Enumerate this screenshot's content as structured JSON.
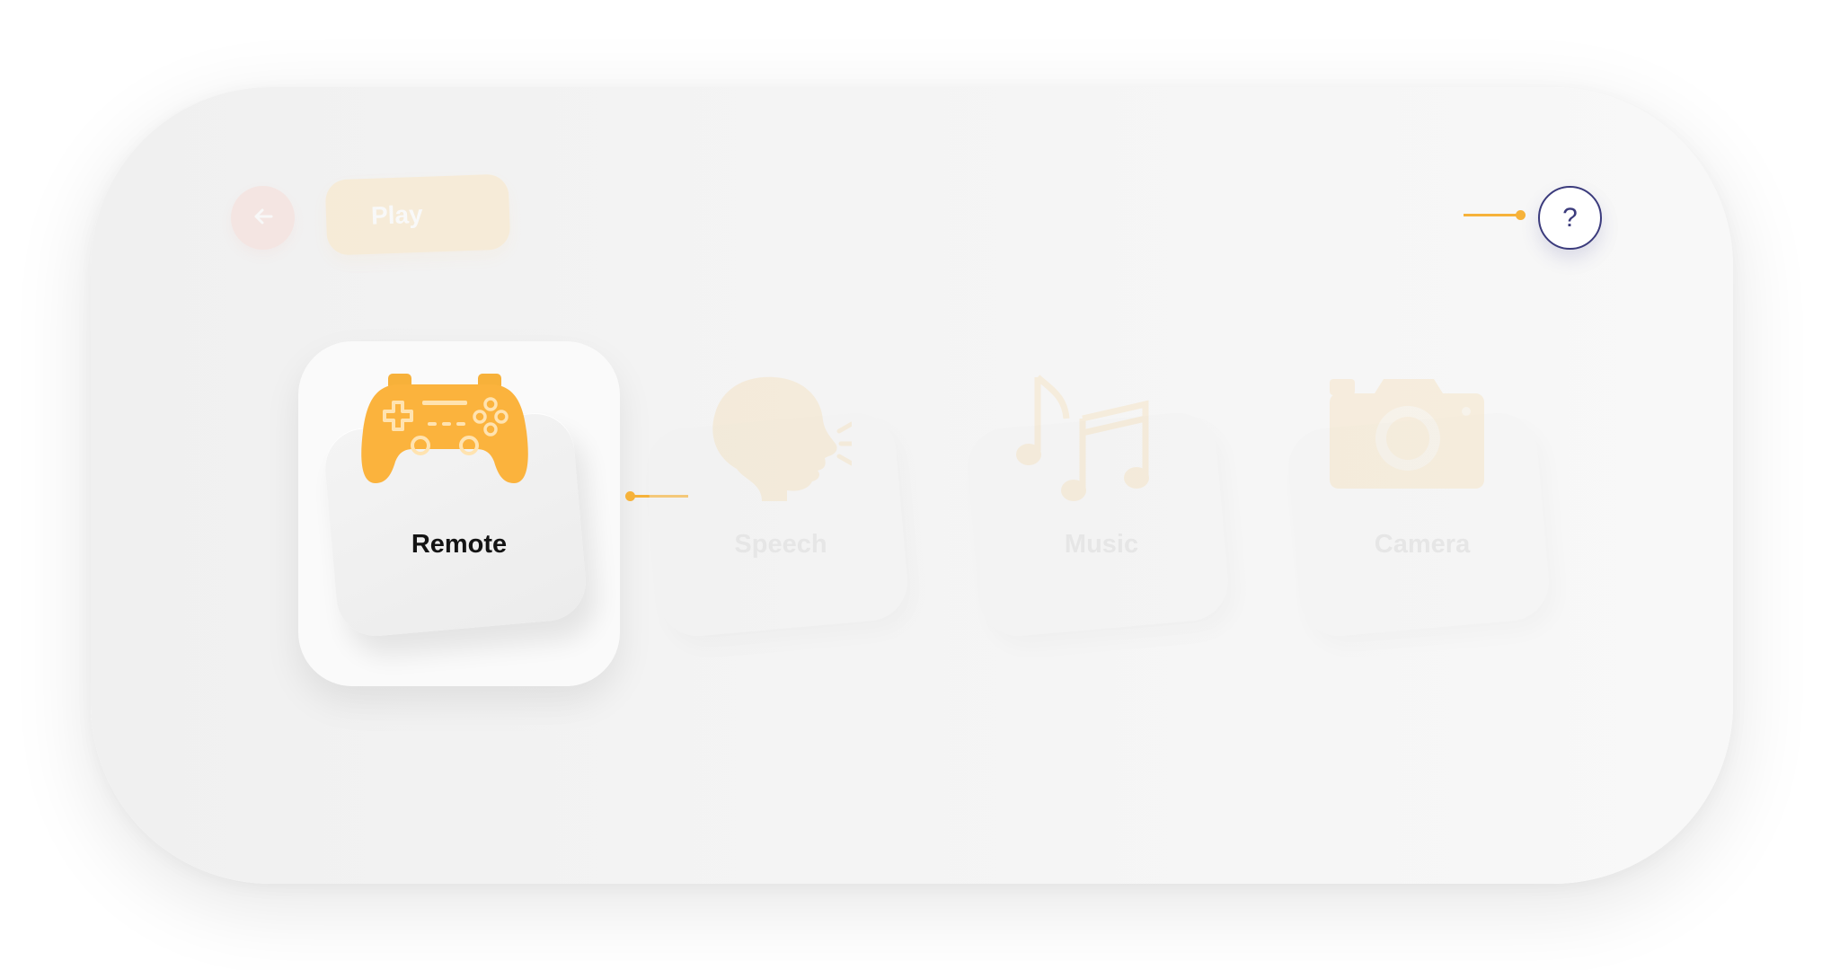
{
  "header": {
    "back_icon": "arrow-left-icon",
    "play_label": "Play",
    "help_label": "?"
  },
  "colors": {
    "accent": "#f6b23a",
    "help_ring": "#3b3b7c",
    "back_bg": "#f7dcd6",
    "play_bg": "#fbe7c3"
  },
  "apps": [
    {
      "label": "Remote",
      "icon": "gamepad-icon",
      "selected": true
    },
    {
      "label": "Speech",
      "icon": "speaking-head-icon",
      "selected": false
    },
    {
      "label": "Music",
      "icon": "music-notes-icon",
      "selected": false
    },
    {
      "label": "Camera",
      "icon": "camera-icon",
      "selected": false
    }
  ]
}
